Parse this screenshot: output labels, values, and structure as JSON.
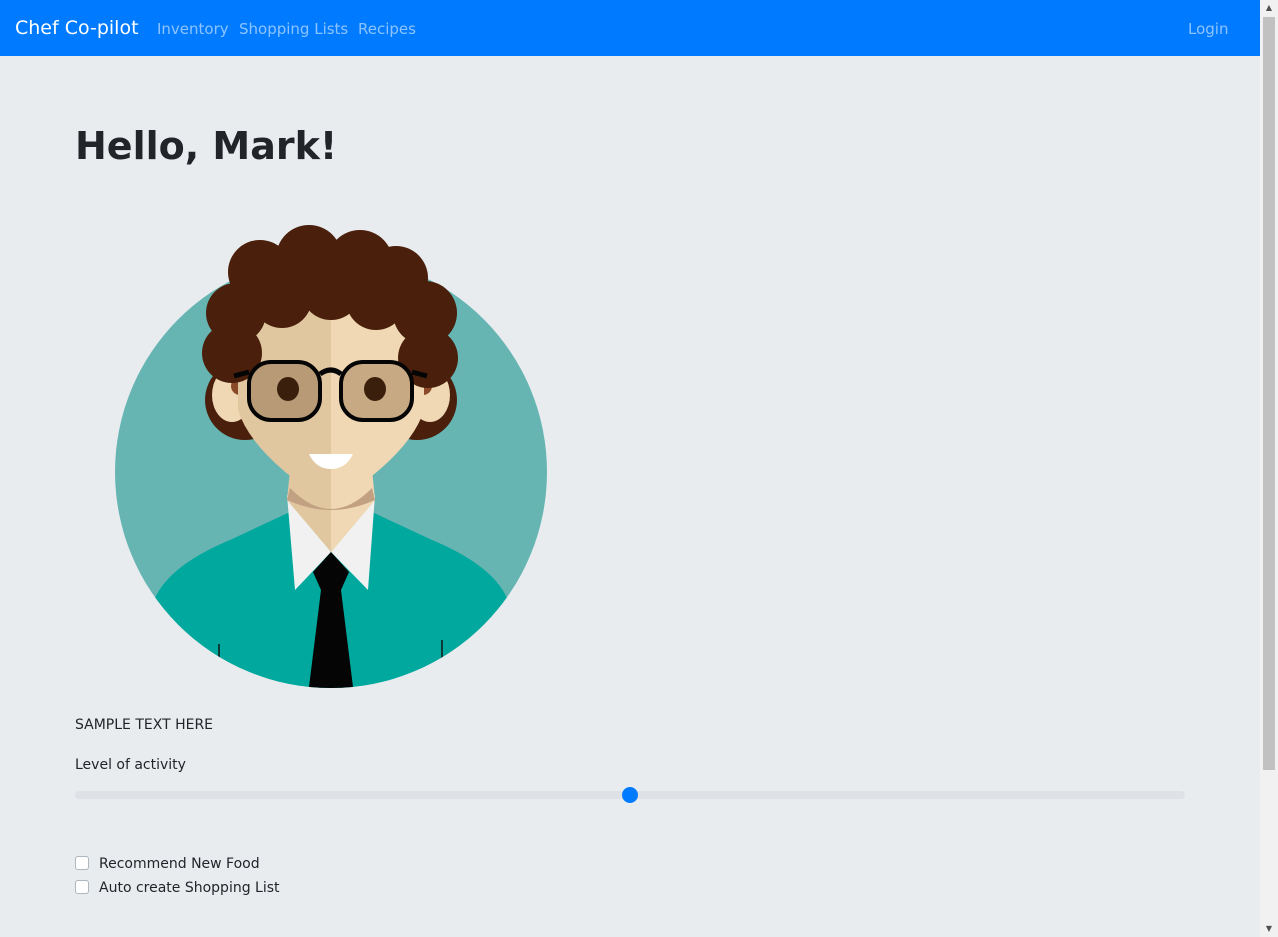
{
  "navbar": {
    "brand": "Chef Co-pilot",
    "links": [
      "Inventory",
      "Shopping Lists",
      "Recipes"
    ],
    "login": "Login",
    "background_color": "#007bff"
  },
  "main": {
    "greeting": "Hello, Mark!",
    "avatar_icon": "user-avatar",
    "sample_text": "SAMPLE TEXT HERE",
    "activity": {
      "label": "Level of activity",
      "value": 0.5,
      "accent_color": "#007bff"
    },
    "options": [
      {
        "label": "Recommend New Food",
        "checked": false
      },
      {
        "label": "Auto create Shopping List",
        "checked": false
      }
    ]
  },
  "page_background": "#e9ecef"
}
